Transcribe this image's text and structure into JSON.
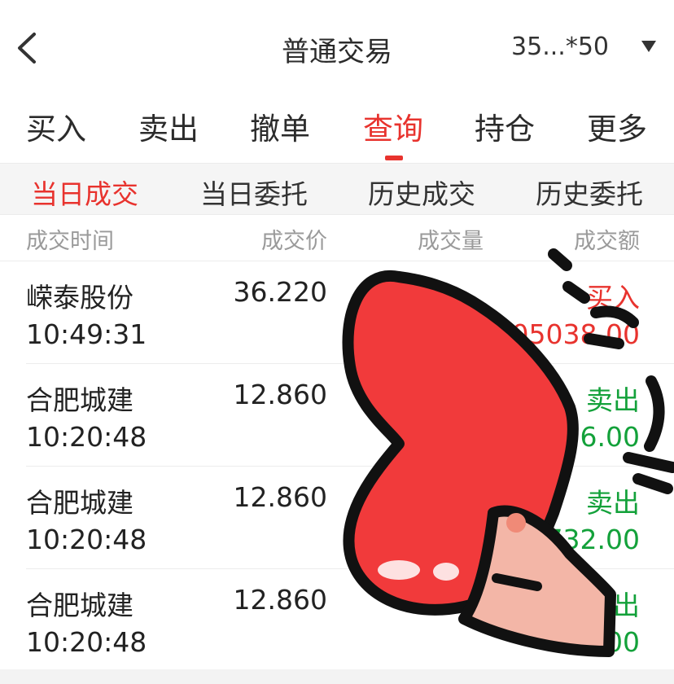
{
  "header": {
    "title": "普通交易",
    "account": "35...*50",
    "back_icon": "chevron-left-icon",
    "dropdown_icon": "triangle-down-icon"
  },
  "tabs": [
    {
      "label": "买入"
    },
    {
      "label": "卖出"
    },
    {
      "label": "撤单"
    },
    {
      "label": "查询",
      "active": true
    },
    {
      "label": "持仓"
    },
    {
      "label": "更多"
    }
  ],
  "subtabs": [
    {
      "label": "当日成交",
      "active": true
    },
    {
      "label": "当日委托"
    },
    {
      "label": "历史成交"
    },
    {
      "label": "历史委托"
    }
  ],
  "columns": [
    "成交时间",
    "成交价",
    "成交量",
    "成交额"
  ],
  "rows": [
    {
      "name": "嵘泰股份",
      "time": "10:49:31",
      "price": "36.220",
      "direction": "买入",
      "amount": "105038.00",
      "type": "buy"
    },
    {
      "name": "合肥城建",
      "time": "10:20:48",
      "price": "12.860",
      "direction": "卖出",
      "amount": "36.00",
      "type": "sell"
    },
    {
      "name": "合肥城建",
      "time": "10:20:48",
      "price": "12.860",
      "direction": "卖出",
      "amount": "732.00",
      "type": "sell"
    },
    {
      "name": "合肥城建",
      "time": "10:20:48",
      "price": "12.860",
      "direction": "卖出",
      "amount": ".00",
      "type": "sell"
    }
  ],
  "colors": {
    "accent": "#e8332e",
    "buy": "#e8332e",
    "sell": "#13a13a",
    "sticker_heart": "#f13a3b"
  },
  "overlay": {
    "icon": "heart-hand-sticker-icon"
  }
}
